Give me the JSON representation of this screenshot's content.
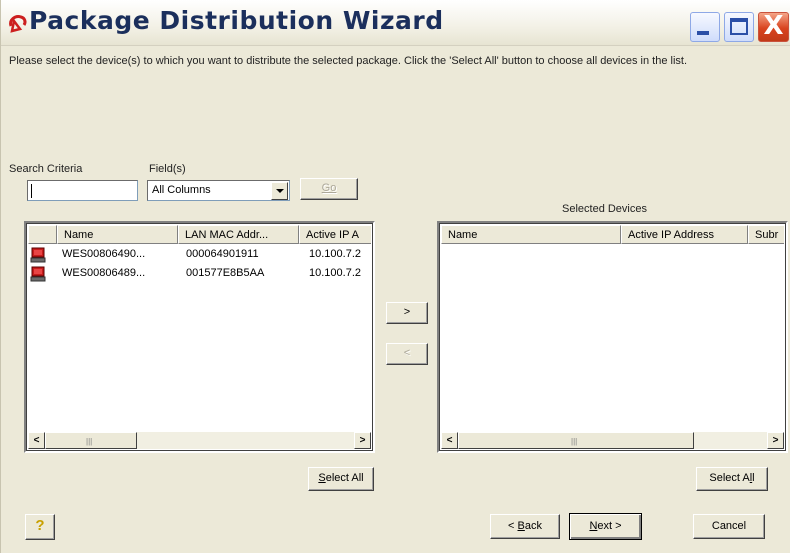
{
  "window": {
    "title": "Package Distribution Wizard",
    "buttons": {
      "minimize_icon": "minimize-icon",
      "maximize_icon": "maximize-icon",
      "close_icon": "close-icon",
      "close_glyph": "X"
    }
  },
  "instructions": "Please select the device(s) to which you want to distribute the selected package.  Click the 'Select All' button to choose all devices in the list.",
  "search": {
    "criteria_label": "Search Criteria",
    "criteria_value": "",
    "fields_label": "Field(s)",
    "fields_selected": "All Columns",
    "go_label": "Go"
  },
  "available_devices": {
    "columns": [
      "",
      "Name",
      "LAN MAC Addr...",
      "Active IP A"
    ],
    "rows": [
      {
        "name": "WES00806490...",
        "mac": "000064901911",
        "ip": "10.100.7.2"
      },
      {
        "name": "WES00806489...",
        "mac": "001577E8B5AA",
        "ip": "10.100.7.2"
      }
    ],
    "select_all_label": "Select All",
    "select_all_underline": "S",
    "select_all_rest": "elect All"
  },
  "transfer": {
    "add_label": ">",
    "remove_label": "<"
  },
  "selected_devices": {
    "caption": "Selected Devices",
    "columns": [
      "Name",
      "Active IP Address",
      "Subr"
    ],
    "select_all_label": "Select All",
    "select_all_pre": "Select A",
    "select_all_underline": "l",
    "select_all_post": "l"
  },
  "scrollbar": {
    "left_arrow": "<",
    "right_arrow": ">",
    "grip": "|||"
  },
  "footer": {
    "help_icon": "help-icon",
    "help_glyph": "?",
    "back_prefix": "< ",
    "back_underline": "B",
    "back_rest": "ack",
    "next_underline": "N",
    "next_rest": "ext >",
    "cancel_label": "Cancel"
  },
  "colors": {
    "title_text": "#1b2f5c",
    "close_button": "#d9431f",
    "window_bg": "#ece9d8",
    "logo_red": "#cc1f1f"
  }
}
